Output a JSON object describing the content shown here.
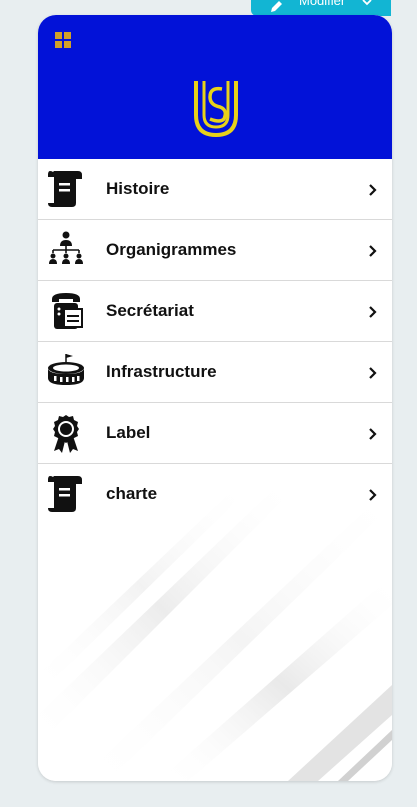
{
  "toolbar": {
    "modifier_label": "Modifier",
    "accent_color": "#12b5d3"
  },
  "header": {
    "background_color": "#0212d8",
    "logo_color": "#e8d21a",
    "logo_text": "US"
  },
  "menu": {
    "items": [
      {
        "label": "Histoire",
        "icon": "scroll-icon"
      },
      {
        "label": "Organigrammes",
        "icon": "org-chart-icon"
      },
      {
        "label": "Secrétariat",
        "icon": "telephone-fax-icon"
      },
      {
        "label": "Infrastructure",
        "icon": "stadium-icon"
      },
      {
        "label": "Label",
        "icon": "award-ribbon-icon"
      },
      {
        "label": "charte",
        "icon": "scroll-icon"
      }
    ]
  }
}
